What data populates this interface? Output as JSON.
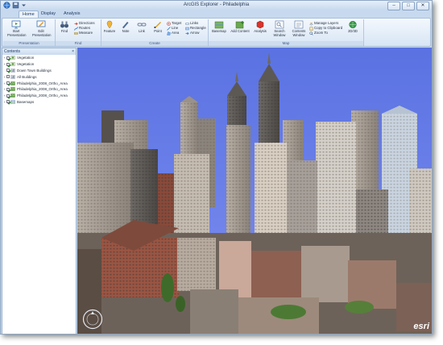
{
  "window": {
    "title": "ArcGIS Explorer - Philadelphia",
    "controls": [
      "–",
      "□",
      "✕"
    ]
  },
  "tabs": [
    {
      "label": "Home",
      "active": true
    },
    {
      "label": "Display",
      "active": false
    },
    {
      "label": "Analysis",
      "active": false
    }
  ],
  "ribbon": {
    "groups": [
      {
        "label": "Presentation",
        "buttons": [
          "Start Presentation",
          "Edit Presentation"
        ]
      },
      {
        "label": "Find",
        "buttons": [
          "Find",
          "Directions",
          "Routes",
          "Measure"
        ]
      },
      {
        "label": "Create",
        "buttons": [
          "Feature",
          "Note",
          "Link",
          "Point",
          "Target",
          "Line",
          "Area",
          "Links",
          "Rectangle",
          "Arrow"
        ]
      },
      {
        "label": "Map",
        "buttons": [
          "Basemap",
          "Add Content",
          "Analysis",
          "Search Window",
          "Contents Window",
          "Manage Layers",
          "Copy to Clipboard",
          "Zoom To",
          "2D/3D"
        ]
      }
    ]
  },
  "contents": {
    "header": "Contents",
    "close": "×",
    "items": [
      {
        "label": "Vegetation",
        "expand": "+",
        "checked": true,
        "icon": "vegetation-layer-icon"
      },
      {
        "label": "Vegetation",
        "expand": "+",
        "checked": true,
        "icon": "vegetation-layer-icon"
      },
      {
        "label": "Down Town Buildings",
        "expand": "",
        "checked": true,
        "icon": "buildings-layer-icon"
      },
      {
        "label": "All Buildings",
        "expand": "+",
        "checked": false,
        "icon": "buildings-layer-icon"
      },
      {
        "label": "Philadelphia_2008_Ortho_Area",
        "expand": "+",
        "checked": true,
        "icon": "imagery-layer-icon"
      },
      {
        "label": "Philadelphia_2008_Ortho_Area",
        "expand": "+",
        "checked": true,
        "icon": "imagery-layer-icon"
      },
      {
        "label": "Philadelphia_2008_Ortho_Area",
        "expand": "+",
        "checked": true,
        "icon": "imagery-layer-icon"
      },
      {
        "label": "Basemaps",
        "expand": "+",
        "checked": true,
        "icon": "basemap-layer-icon"
      }
    ]
  },
  "scene": {
    "logo": "esri",
    "sky_color": "#5e75e0"
  }
}
